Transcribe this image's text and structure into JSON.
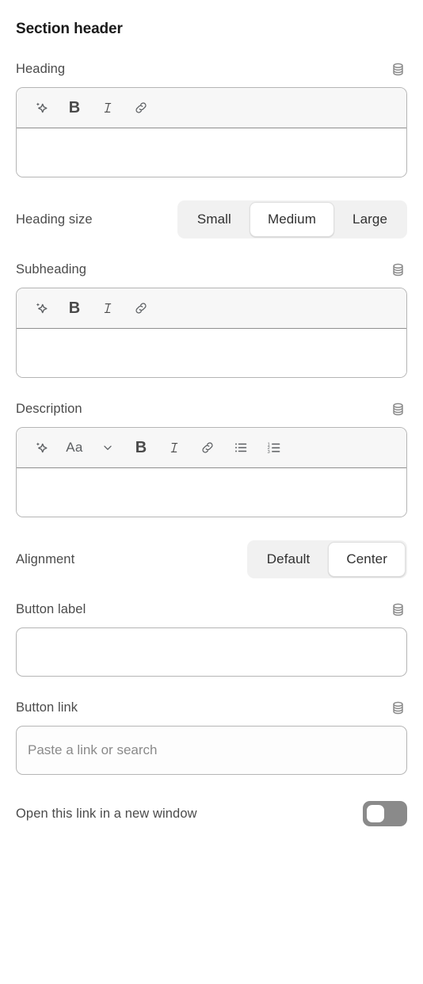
{
  "panel": {
    "title": "Section header"
  },
  "fields": {
    "heading": {
      "label": "Heading",
      "value": "",
      "metafield_icon": "database-icon",
      "toolbar": [
        {
          "name": "ai-sparkle-icon",
          "label": ""
        },
        {
          "name": "bold-icon",
          "label": "B"
        },
        {
          "name": "italic-icon",
          "label": "I"
        },
        {
          "name": "link-icon",
          "label": ""
        }
      ]
    },
    "heading_size": {
      "label": "Heading size",
      "options": [
        "Small",
        "Medium",
        "Large"
      ],
      "selected": "Medium"
    },
    "subheading": {
      "label": "Subheading",
      "value": "",
      "metafield_icon": "database-icon",
      "toolbar": [
        {
          "name": "ai-sparkle-icon",
          "label": ""
        },
        {
          "name": "bold-icon",
          "label": "B"
        },
        {
          "name": "italic-icon",
          "label": "I"
        },
        {
          "name": "link-icon",
          "label": ""
        }
      ]
    },
    "description": {
      "label": "Description",
      "value": "",
      "metafield_icon": "database-icon",
      "font_style_label": "Aa",
      "toolbar": [
        {
          "name": "ai-sparkle-icon",
          "label": ""
        },
        {
          "name": "font-style-icon",
          "label": "Aa"
        },
        {
          "name": "chevron-down-icon",
          "label": ""
        },
        {
          "name": "bold-icon",
          "label": "B"
        },
        {
          "name": "italic-icon",
          "label": "I"
        },
        {
          "name": "link-icon",
          "label": ""
        },
        {
          "name": "bulleted-list-icon",
          "label": ""
        },
        {
          "name": "numbered-list-icon",
          "label": ""
        }
      ]
    },
    "alignment": {
      "label": "Alignment",
      "options": [
        "Default",
        "Center"
      ],
      "selected": "Center"
    },
    "button_label": {
      "label": "Button label",
      "value": "",
      "placeholder": "",
      "metafield_icon": "database-icon"
    },
    "button_link": {
      "label": "Button link",
      "value": "",
      "placeholder": "Paste a link or search",
      "metafield_icon": "database-icon"
    },
    "new_window": {
      "label": "Open this link in a new window",
      "state": "off"
    }
  },
  "colors": {
    "text": "#303030",
    "label": "#4b4b4b",
    "border": "#b5b5b5",
    "toolbar_bg": "#f7f7f7",
    "segmented_track": "#f1f1f1",
    "toggle_off": "#8a8a8a",
    "placeholder": "#8a8a8a"
  }
}
